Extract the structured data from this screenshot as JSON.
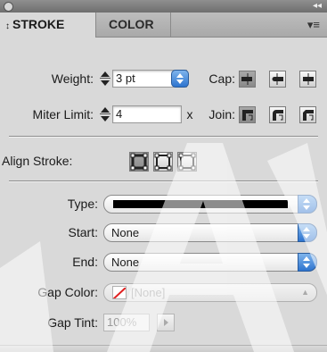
{
  "tabs": [
    {
      "label": "STROKE",
      "arrows": "↕"
    },
    {
      "label": "COLOR"
    }
  ],
  "panel_menu": "▾≡",
  "weight": {
    "label": "Weight:",
    "value": "3 pt"
  },
  "cap": {
    "label": "Cap:"
  },
  "miter": {
    "label": "Miter Limit:",
    "value": "4",
    "unit": "x"
  },
  "join": {
    "label": "Join:"
  },
  "align_stroke": {
    "label": "Align Stroke:"
  },
  "type": {
    "label": "Type:",
    "color": "#000000"
  },
  "start": {
    "label": "Start:",
    "value": "None"
  },
  "end": {
    "label": "End:",
    "value": "None"
  },
  "gap_color": {
    "label": "Gap Color:",
    "value": "[None]"
  },
  "gap_tint": {
    "label": "Gap Tint:",
    "value": "100%"
  },
  "colors": {
    "accent": "#2e74cf",
    "panel": "#d9d9d9",
    "swatch_none": "#e02020"
  }
}
